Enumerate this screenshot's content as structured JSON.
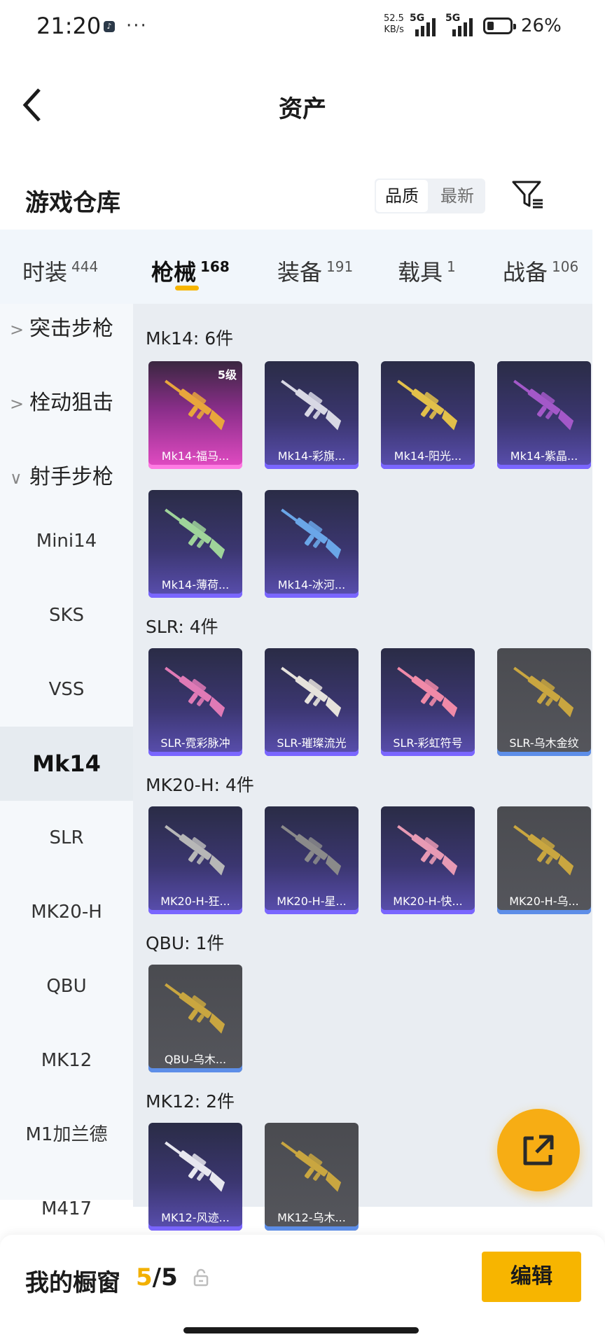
{
  "status_bar": {
    "time": "21:20",
    "tiktok_icon": "♪",
    "dots": "···",
    "net_speed_value": "52.5",
    "net_speed_unit": "KB/s",
    "sig1_label": "5G",
    "sig2_label": "5G",
    "battery": "26%"
  },
  "header": {
    "title": "资产"
  },
  "warehouse": {
    "title": "游戏仓库",
    "sort_options": [
      "品质",
      "最新"
    ]
  },
  "tabs": [
    {
      "label": "时装",
      "count": "444"
    },
    {
      "label": "枪械",
      "count": "168"
    },
    {
      "label": "装备",
      "count": "191"
    },
    {
      "label": "载具",
      "count": "1"
    },
    {
      "label": "战备",
      "count": "106"
    }
  ],
  "sidebar": {
    "categories": [
      "突击步枪",
      "栓动狙击",
      "射手步枪"
    ],
    "chevrons": [
      ">",
      ">",
      "∨"
    ],
    "items": [
      "Mini14",
      "SKS",
      "VSS",
      "Mk14",
      "SLR",
      "MK20-H",
      "QBU",
      "MK12",
      "M1加兰德",
      "M417"
    ]
  },
  "sections": [
    {
      "title": "Mk14: 6件",
      "items": [
        {
          "label": "Mk14-福马...",
          "level": "5级",
          "style": "pink",
          "color": "#e8a63c"
        },
        {
          "label": "Mk14-彩旗...",
          "style": "purple",
          "color": "#d8d8e4"
        },
        {
          "label": "Mk14-阳光...",
          "style": "purple",
          "color": "#e2c04a"
        },
        {
          "label": "Mk14-紫晶...",
          "style": "purple",
          "color": "#a358c8"
        },
        {
          "label": "Mk14-薄荷...",
          "style": "purple",
          "color": "#9fd49a"
        },
        {
          "label": "Mk14-冰河...",
          "style": "purple",
          "color": "#6aa6e8"
        }
      ]
    },
    {
      "title": "SLR: 4件",
      "items": [
        {
          "label": "SLR-霓彩脉冲",
          "style": "purple",
          "color": "#e07ab6"
        },
        {
          "label": "SLR-璀璨流光",
          "style": "purple",
          "color": "#e6e2dc"
        },
        {
          "label": "SLR-彩虹符号",
          "style": "purple",
          "color": "#f08aa8"
        },
        {
          "label": "SLR-乌木金纹",
          "style": "gray",
          "color": "#c9a640"
        }
      ]
    },
    {
      "title": "MK20-H: 4件",
      "items": [
        {
          "label": "MK20-H-狂...",
          "style": "purple",
          "color": "#b7b7b7"
        },
        {
          "label": "MK20-H-星...",
          "style": "purple",
          "color": "#8a8a8a"
        },
        {
          "label": "MK20-H-快...",
          "style": "purple",
          "color": "#e79ab4"
        },
        {
          "label": "MK20-H-乌...",
          "style": "gray",
          "color": "#c9a640"
        }
      ]
    },
    {
      "title": "QBU: 1件",
      "items": [
        {
          "label": "QBU-乌木...",
          "style": "gray",
          "color": "#c9a640"
        }
      ]
    },
    {
      "title": "MK12: 2件",
      "items": [
        {
          "label": "MK12-风迹...",
          "style": "purple",
          "color": "#e7e7ef"
        },
        {
          "label": "MK12-乌木...",
          "style": "gray",
          "color": "#c9a640"
        }
      ]
    }
  ],
  "showcase": {
    "label": "我的橱窗",
    "current": "5",
    "separator": "/",
    "max": "5",
    "edit_label": "编辑"
  },
  "colors": {
    "accent": "#f7b500",
    "fab": "#f7ad14"
  }
}
